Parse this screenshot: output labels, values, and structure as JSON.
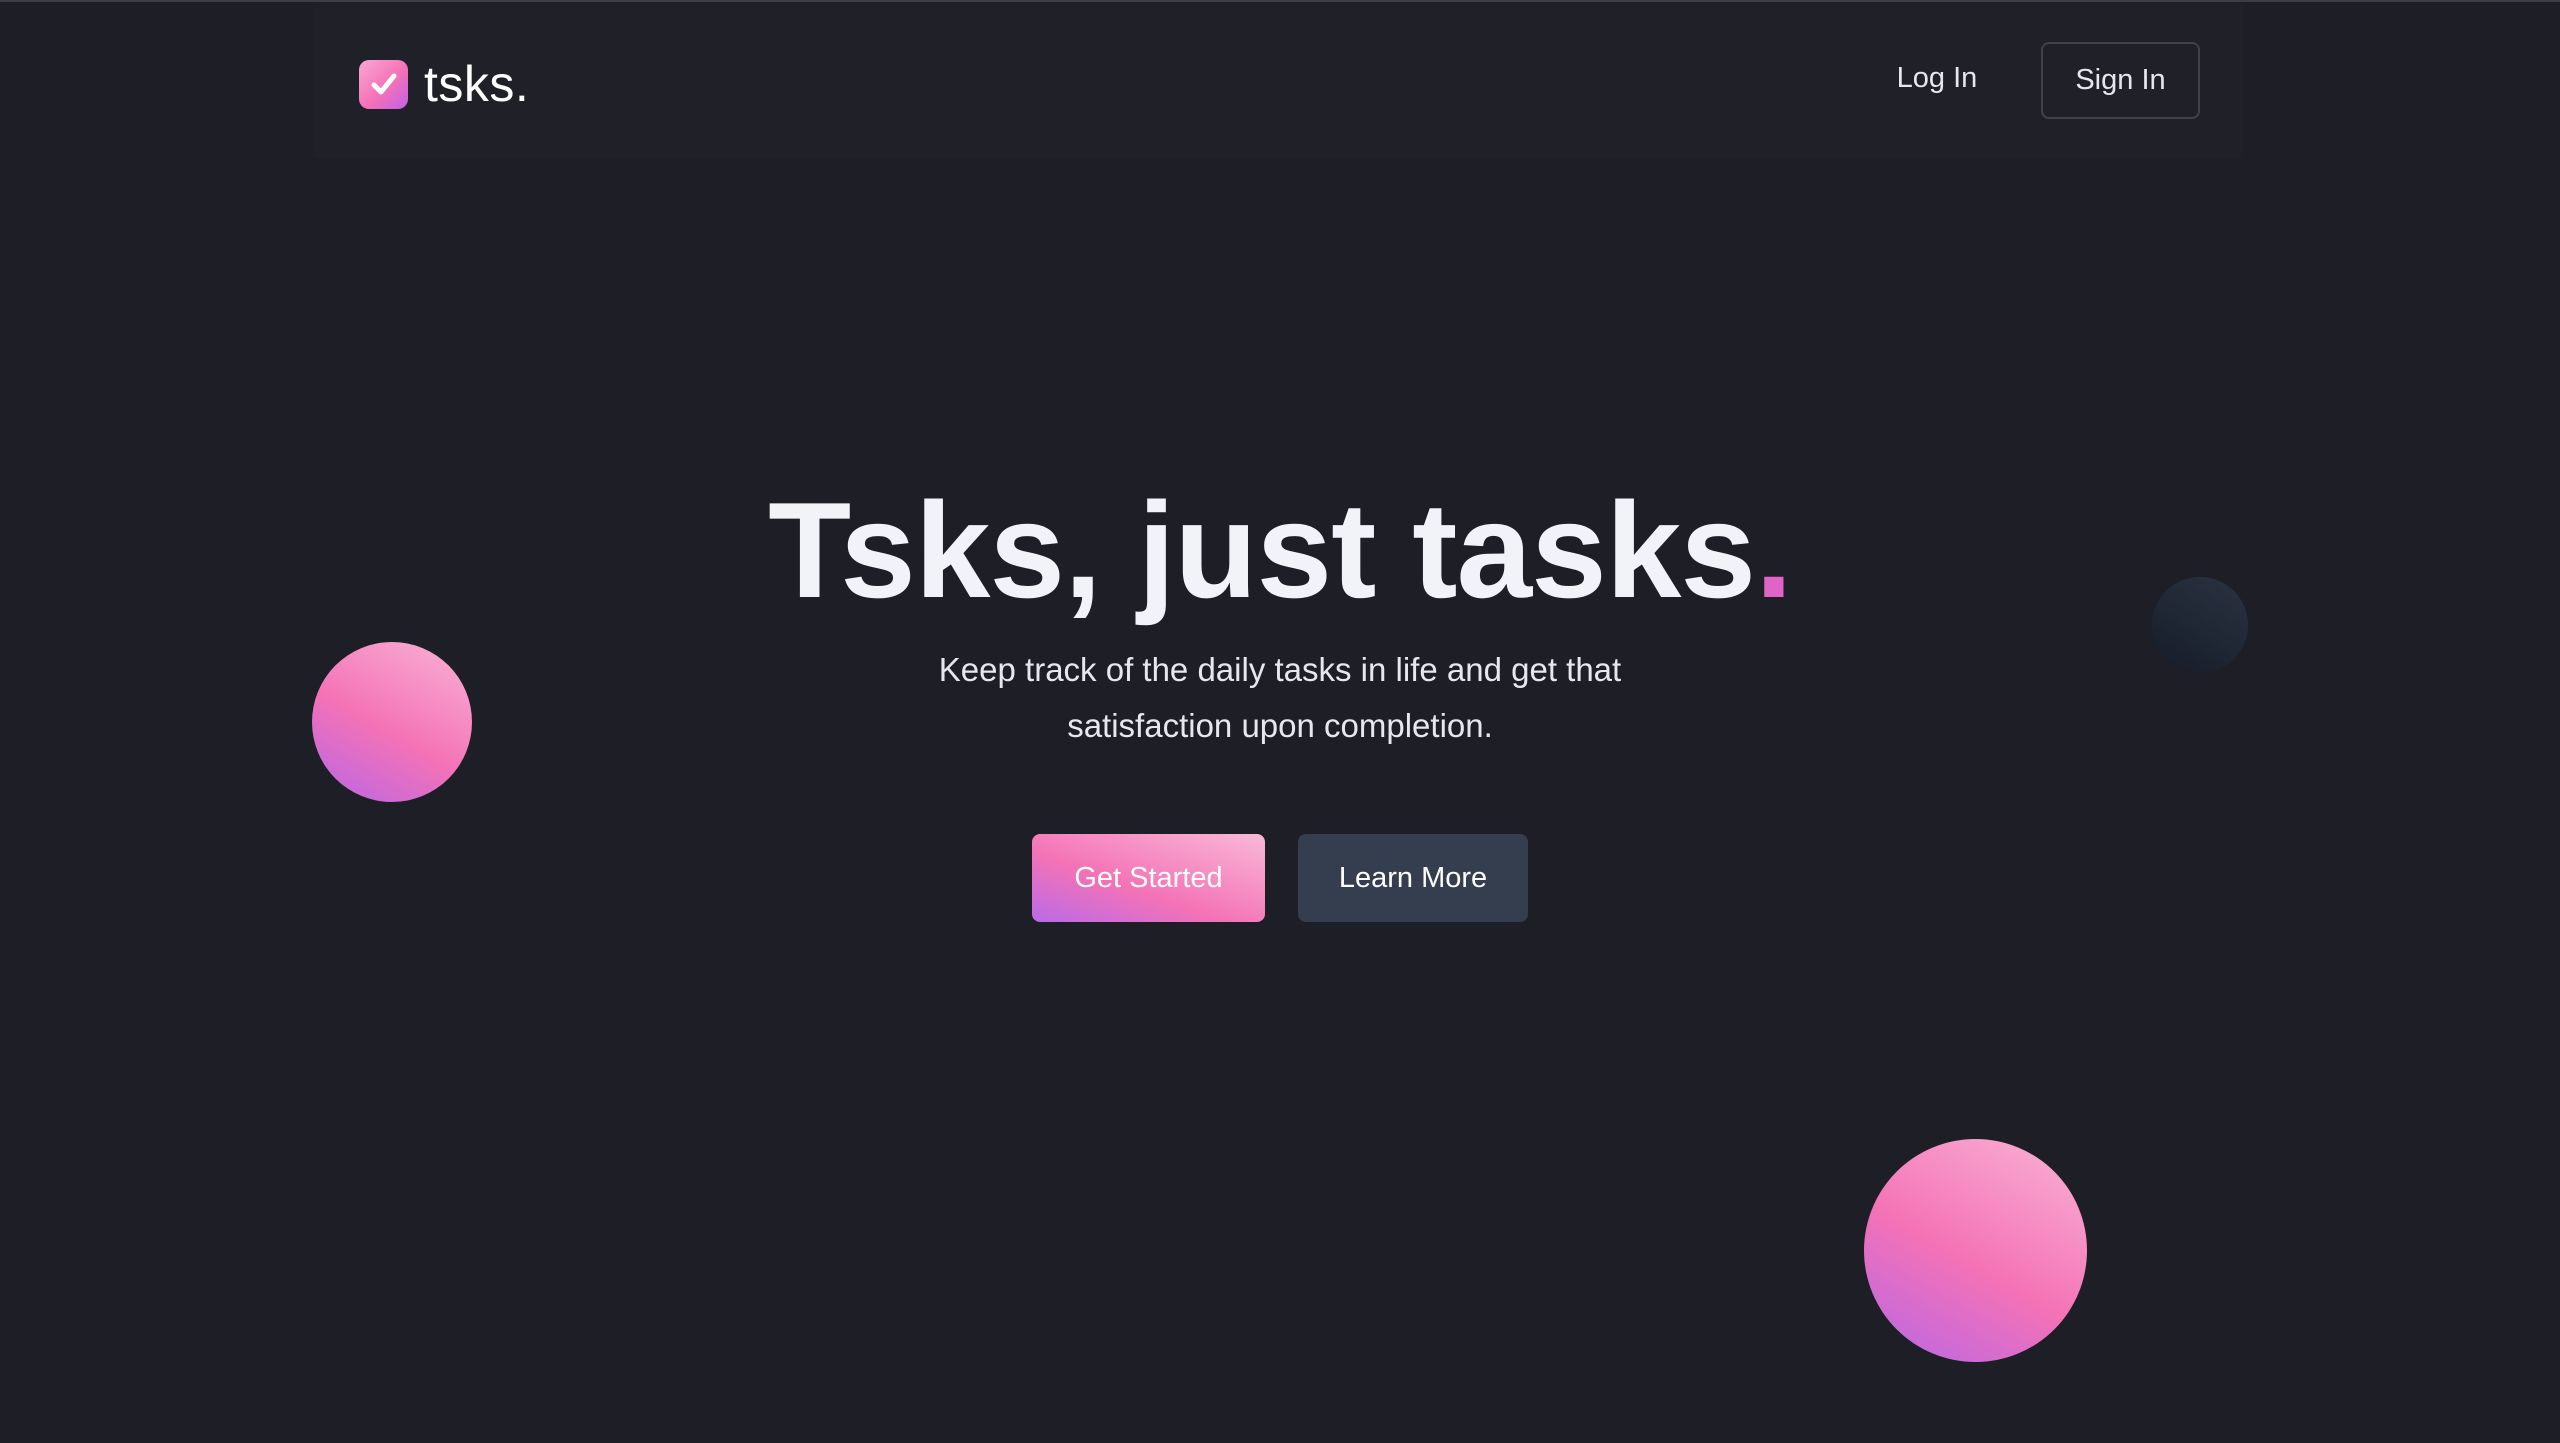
{
  "brand": {
    "name": "tsks.",
    "logo_icon": "checkbox-check-icon"
  },
  "nav": {
    "login_label": "Log In",
    "signin_label": "Sign In"
  },
  "hero": {
    "title_main": "Tsks, just tasks",
    "title_dot": ".",
    "subtitle": "Keep track of the daily tasks in life and get that satisfaction upon completion.",
    "primary_button": "Get Started",
    "secondary_button": "Learn More"
  },
  "colors": {
    "background": "#1e1f26",
    "accent_pink": "#f472b6",
    "accent_purple": "#c061e8",
    "secondary_button": "#353e4e"
  }
}
